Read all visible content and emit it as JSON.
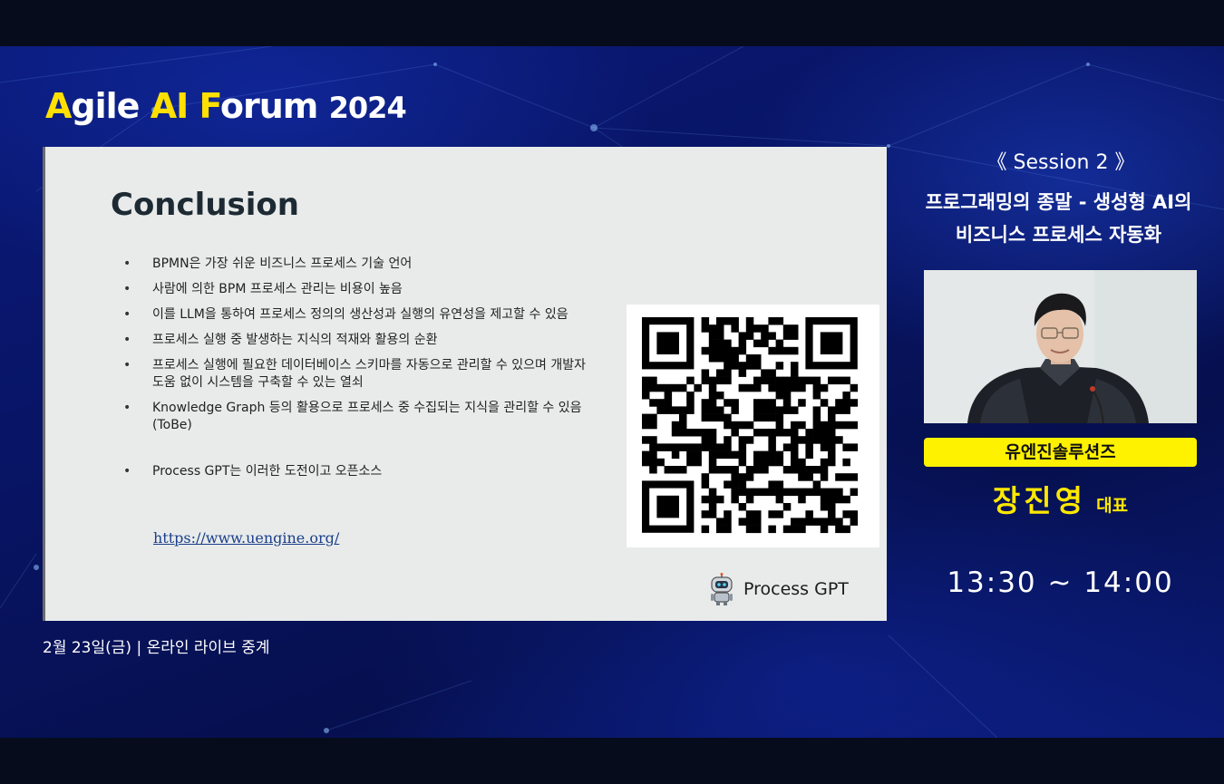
{
  "header": {
    "title_parts": {
      "a": "A",
      "gile": "gile ",
      "ai": "AI",
      "f": "F",
      "orum": "orum ",
      "year": "2024"
    }
  },
  "slide": {
    "heading": "Conclusion",
    "bullets": [
      "BPMN은 가장 쉬운 비즈니스 프로세스 기술 언어",
      "사람에 의한 BPM 프로세스 관리는 비용이 높음",
      "이를 LLM을 통하여 프로세스 정의의 생산성과 실행의 유연성을 제고할 수 있음",
      "프로세스 실행 중 발생하는 지식의 적재와 활용의 순환",
      "프로세스 실행에 필요한 데이터베이스 스키마를 자동으로 관리할 수 있으며 개발자 도움 없이 시스템을 구축할 수 있는 열쇠",
      "Knowledge Graph 등의 활용으로 프로세스 중 수집되는 지식을 관리할 수 있음 (ToBe)",
      "Process GPT는 이러한 도전이고 오픈소스"
    ],
    "bullet_marker": "•",
    "link_text": "https://www.uengine.org/",
    "brand_label": "Process GPT"
  },
  "session": {
    "label": "《 Session  2 》",
    "topic_line1": "프로그래밍의 종말 - 생성형 AI의",
    "topic_line2": "비즈니스 프로세스 자동화",
    "company": "유엔진솔루션즈",
    "speaker_name": "장진영",
    "speaker_role": "대표",
    "time": "13:30 ~ 14:00"
  },
  "footer": {
    "event_info": "2월 23일(금)  |  온라인 라이브 중계"
  },
  "colors": {
    "accent_yellow": "#ffe000",
    "badge_yellow": "#fff200",
    "background_blue": "#081463",
    "slide_bg": "#e8ebea",
    "link_blue": "#1b3f8a"
  }
}
